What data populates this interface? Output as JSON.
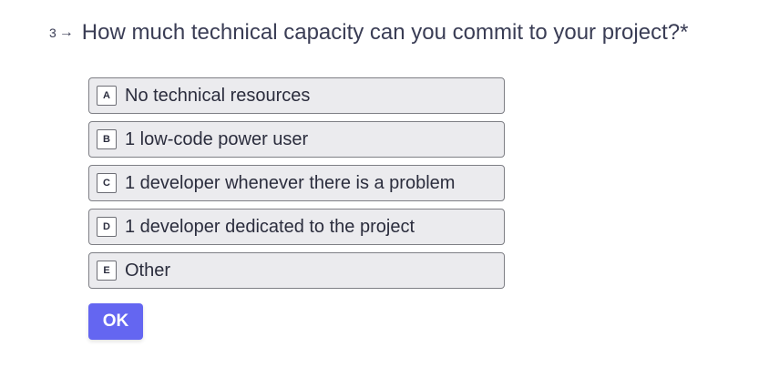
{
  "question": {
    "number": "3",
    "arrow": "→",
    "text": "How much technical capacity can you commit to your project?*"
  },
  "options": [
    {
      "key": "A",
      "label": "No technical resources"
    },
    {
      "key": "B",
      "label": "1 low-code power user"
    },
    {
      "key": "C",
      "label": "1 developer whenever there is a problem"
    },
    {
      "key": "D",
      "label": "1 developer dedicated to the project"
    },
    {
      "key": "E",
      "label": "Other"
    }
  ],
  "submit": {
    "label": "OK"
  },
  "colors": {
    "accent": "#6466f1",
    "option_bg": "#ebebee",
    "text": "#3a3d55"
  }
}
